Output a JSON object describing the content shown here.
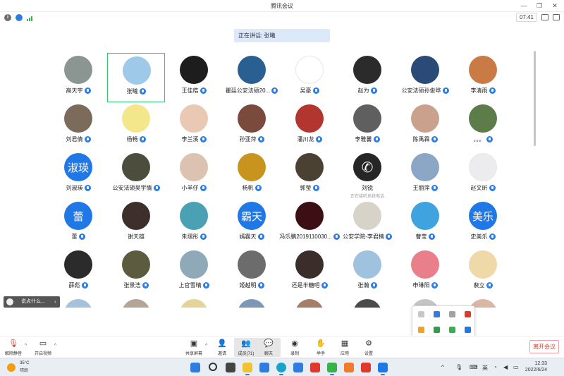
{
  "window": {
    "title": "腾讯会议",
    "timer": "07:41"
  },
  "speaking": "正在讲话: 张曦",
  "participants": [
    {
      "name": "高天宇",
      "mic": true,
      "bg": "#8b9693"
    },
    {
      "name": "张曦",
      "mic": true,
      "bg": "#9ec9e8",
      "active": true
    },
    {
      "name": "王佳皓",
      "mic": true,
      "bg": "#1d1d1d"
    },
    {
      "name": "瞿廷公安法硕20...",
      "mic": true,
      "bg": "#2a5f91"
    },
    {
      "name": "吴豪",
      "mic": true,
      "bg": "#ffffff"
    },
    {
      "name": "赵为",
      "mic": true,
      "bg": "#2b2b2b"
    },
    {
      "name": "公安法硕孙俊晔",
      "mic": true,
      "bg": "#2a4b78"
    },
    {
      "name": "李清雨",
      "mic": true,
      "bg": "#c97a45"
    },
    {
      "name": "刘君倩",
      "mic": true,
      "bg": "#7c6a5a"
    },
    {
      "name": "杨畅",
      "mic": true,
      "bg": "#f4e68b"
    },
    {
      "name": "李兰溪",
      "mic": true,
      "bg": "#e9c9b3"
    },
    {
      "name": "孙亚萍",
      "mic": true,
      "bg": "#7a4a3c"
    },
    {
      "name": "潘川龙",
      "mic": true,
      "bg": "#b3352f"
    },
    {
      "name": "李雅馨",
      "mic": true,
      "bg": "#5f5f5f"
    },
    {
      "name": "陈禹霖",
      "mic": true,
      "bg": "#c9a18c"
    },
    {
      "name": "。。。",
      "mic": true,
      "bg": "#5c7d4a"
    },
    {
      "name": "刘淑瑛",
      "mic": true,
      "bg": "#1f78e6",
      "text": "淑瑛"
    },
    {
      "name": "公安法硕吴宇情",
      "mic": true,
      "bg": "#4d4d3d"
    },
    {
      "name": "小羊仔",
      "mic": true,
      "bg": "#dcc2b0"
    },
    {
      "name": "杨帆",
      "mic": true,
      "bg": "#c9941e"
    },
    {
      "name": "郭莹",
      "mic": true,
      "bg": "#4a4133"
    },
    {
      "name": "刘锐",
      "mic": false,
      "bg": "#262626",
      "glyph": "✆",
      "sub": "正在接听系统电话"
    },
    {
      "name": "王丽萍",
      "mic": true,
      "bg": "#8ba7c5"
    },
    {
      "name": "赵文昕",
      "mic": true,
      "bg": "#ececef"
    },
    {
      "name": "蕾",
      "mic": true,
      "bg": "#1f78e6",
      "text": "蕾"
    },
    {
      "name": "谢天雄",
      "mic": false,
      "bg": "#3d2f29"
    },
    {
      "name": "朱熠彤",
      "mic": true,
      "bg": "#4aa1b3"
    },
    {
      "name": "嫣霸天",
      "mic": true,
      "bg": "#1f78e6",
      "text": "霸天"
    },
    {
      "name": "冯乐鹏2019110030...",
      "mic": true,
      "bg": "#3b0f14"
    },
    {
      "name": "公安学院-李君楠",
      "mic": true,
      "bg": "#d8d3c8"
    },
    {
      "name": "曹莹",
      "mic": true,
      "bg": "#3fa3e0"
    },
    {
      "name": "史美乐",
      "mic": true,
      "bg": "#1f78e6",
      "text": "美乐"
    },
    {
      "name": "薛彪",
      "mic": true,
      "bg": "#2b2b2b"
    },
    {
      "name": "张景浩",
      "mic": true,
      "bg": "#5c5a3f"
    },
    {
      "name": "上官雪晴",
      "mic": true,
      "bg": "#8fa9b8"
    },
    {
      "name": "姬越明",
      "mic": true,
      "bg": "#6c6c6c"
    },
    {
      "name": "还是半糖吧",
      "mic": true,
      "bg": "#3a2d2a"
    },
    {
      "name": "张瀚",
      "mic": true,
      "bg": "#9fc2df"
    },
    {
      "name": "申琳阳",
      "mic": true,
      "bg": "#e87f8b"
    },
    {
      "name": "裴立",
      "mic": true,
      "bg": "#efd9a8"
    },
    {
      "name": "",
      "mic": false,
      "bg": "#a7c1dd"
    },
    {
      "name": "",
      "mic": false,
      "bg": "#b4a596"
    },
    {
      "name": "",
      "mic": false,
      "bg": "#e6d39a"
    },
    {
      "name": "",
      "mic": false,
      "bg": "#7f97b7"
    },
    {
      "name": "",
      "mic": false,
      "bg": "#a87c6a"
    },
    {
      "name": "",
      "mic": false,
      "bg": "#4b4b4b"
    },
    {
      "name": "",
      "mic": false,
      "bg": "#c4c4c4"
    },
    {
      "name": "",
      "mic": false,
      "bg": "#d8b7a3"
    }
  ],
  "chat_pill": "说点什么...",
  "toolbar": {
    "unmute": "解除静音",
    "video": "开启视频",
    "share": "共享屏幕",
    "invite": "邀请",
    "members": "成员(71)",
    "chat": "聊天",
    "record": "录制",
    "raise_hand": "举手",
    "apps": "应用",
    "settings": "设置",
    "leave": "离开会议"
  },
  "taskbar": {
    "temp": "35°C",
    "condition": "晴朗",
    "ime": "英",
    "time": "12:33",
    "date": "2022/6/24"
  }
}
